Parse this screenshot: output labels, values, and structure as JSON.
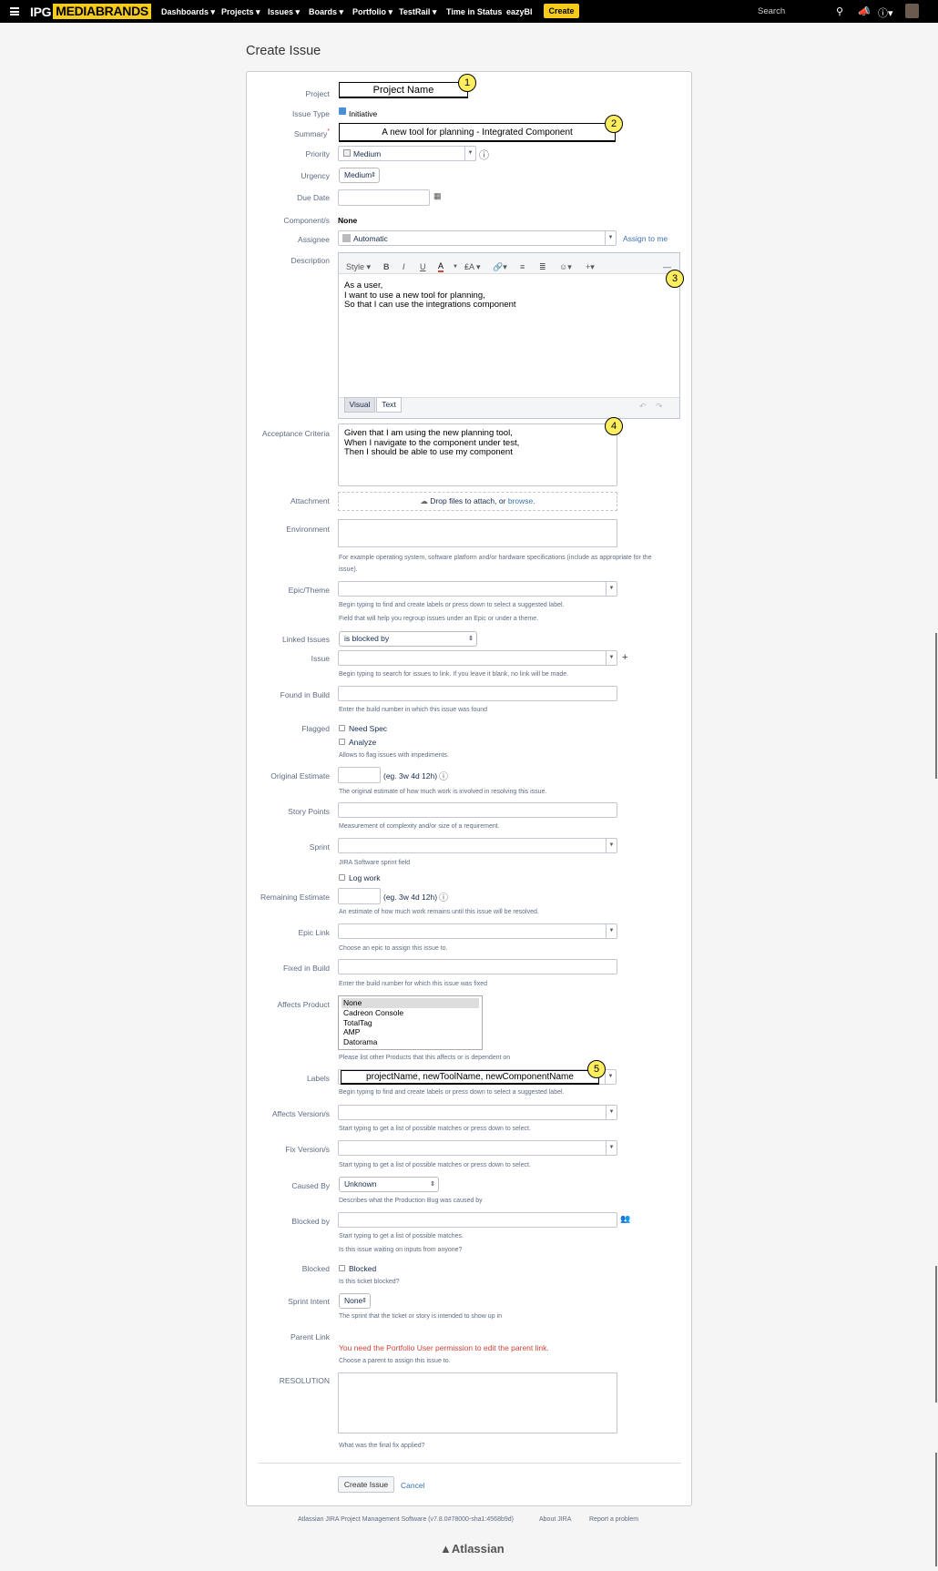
{
  "nav": {
    "logo_ipg": "IPG",
    "logo_mb": "MEDIABRANDS",
    "items": [
      "Dashboards ▾",
      "Projects ▾",
      "Issues ▾",
      "Boards ▾",
      "Portfolio ▾",
      "TestRail ▾",
      "Time in Status",
      "eazyBI"
    ],
    "create": "Create",
    "search_placeholder": "Search",
    "icons": [
      "search-icon",
      "megaphone-icon",
      "help-icon",
      "avatar"
    ]
  },
  "page_title": "Create Issue",
  "fields": {
    "project_label": "Project",
    "project_value": "Project Name",
    "issue_type_label": "Issue Type",
    "issue_type_value": "Initiative",
    "summary_label": "Summary",
    "summary_required": "*",
    "summary_value": "A new tool for planning - Integrated Component",
    "priority_label": "Priority",
    "priority_value": "Medium",
    "urgency_label": "Urgency",
    "urgency_value": "Medium",
    "due_date_label": "Due Date",
    "components_label": "Component/s",
    "components_value": "None",
    "assignee_label": "Assignee",
    "assignee_value": "Automatic",
    "assign_to_me": "Assign to me",
    "description_label": "Description",
    "description_toolbar_style": "Style",
    "description_lines": [
      "As a user,",
      "I want to use a new tool for planning,",
      "So that I can use the integrations component"
    ],
    "tab_visual": "Visual",
    "tab_text": "Text",
    "acceptance_label": "Acceptance Criteria",
    "acceptance_lines": [
      "Given that I am using the new planning tool,",
      "When I navigate to the component under test,",
      "Then I should be able to use my component"
    ],
    "attachment_label": "Attachment",
    "attachment_text": "Drop files to attach, or",
    "attachment_link": "browse.",
    "environment_label": "Environment",
    "environment_help1": "For example operating system, software platform and/or hardware specifications (include as appropriate for the",
    "environment_help2": "issue).",
    "epic_theme_label": "Epic/Theme",
    "epic_theme_help1": "Begin typing to find and create labels or press down to select a suggested label.",
    "epic_theme_help2": "Field that will help you regroup issues under an Epic or under a theme.",
    "linked_issues_label": "Linked Issues",
    "linked_issues_value": "is blocked by",
    "issue_label": "Issue",
    "issue_help": "Begin typing to search for issues to link. If you leave it blank, no link will be made.",
    "found_in_build_label": "Found in Build",
    "found_in_build_help": "Enter the build number in which this issue was found",
    "flagged_label": "Flagged",
    "flagged_opt1": "Need Spec",
    "flagged_opt2": "Analyze",
    "flagged_help": "Allows to flag issues with impediments.",
    "original_estimate_label": "Original Estimate",
    "estimate_hint": "(eg. 3w 4d 12h)",
    "original_estimate_help": "The original estimate of how much work is involved in resolving this issue.",
    "story_points_label": "Story Points",
    "story_points_help": "Measurement of complexity and/or size of a requirement.",
    "sprint_label": "Sprint",
    "sprint_help": "JIRA Software sprint field",
    "log_work": "Log work",
    "remaining_estimate_label": "Remaining Estimate",
    "remaining_estimate_help": "An estimate of how much work remains until this issue will be resolved.",
    "epic_link_label": "Epic Link",
    "epic_link_help": "Choose an epic to assign this issue to.",
    "fixed_in_build_label": "Fixed in Build",
    "fixed_in_build_help": "Enter the build number for which this issue was fixed",
    "affects_product_label": "Affects Product",
    "affects_product_options": [
      "None",
      "Cadreon Console",
      "TotalTag",
      "AMP",
      "Datorama"
    ],
    "affects_product_help": "Please list other Products that this affects or is dependent on",
    "labels_label": "Labels",
    "labels_value": "projectName, newToolName, newComponentName",
    "labels_help": "Begin typing to find and create labels or press down to select a suggested label.",
    "affects_version_label": "Affects Version/s",
    "affects_version_help": "Start typing to get a list of possible matches or press down to select.",
    "fix_version_label": "Fix Version/s",
    "fix_version_help": "Start typing to get a list of possible matches or press down to select.",
    "caused_by_label": "Caused By",
    "caused_by_value": "Unknown",
    "caused_by_help": "Describes what the Production Bug was caused by",
    "blocked_by_label": "Blocked by",
    "blocked_by_help1": "Start typing to get a list of possible matches.",
    "blocked_by_help2": "Is this issue waiting on inputs from anyone?",
    "blocked_label": "Blocked",
    "blocked_opt": "Blocked",
    "blocked_help": "Is this ticket blocked?",
    "sprint_intent_label": "Sprint Intent",
    "sprint_intent_value": "None",
    "sprint_intent_help": "The sprint that the ticket or story is intended to show up in",
    "parent_link_label": "Parent Link",
    "parent_link_error": "You need the Portfolio User permission to edit the parent link.",
    "parent_link_help": "Choose a parent to assign this issue to.",
    "resolution_label": "RESOLUTION",
    "resolution_help": "What was the final fix applied?"
  },
  "callouts": [
    "1",
    "2",
    "3",
    "4",
    "5"
  ],
  "actions": {
    "create_issue": "Create Issue",
    "cancel": "Cancel"
  },
  "footer": {
    "version": "Atlassian JIRA Project Management Software (v7.8.0#78000-sha1:4568b9d)",
    "about": "About JIRA",
    "report": "Report a problem",
    "brand": "Atlassian"
  },
  "colors": {
    "brand_yellow": "#f5cc1b",
    "callout_yellow": "#ffef5e",
    "link_blue": "#3b73af",
    "error_red": "#d04437"
  }
}
